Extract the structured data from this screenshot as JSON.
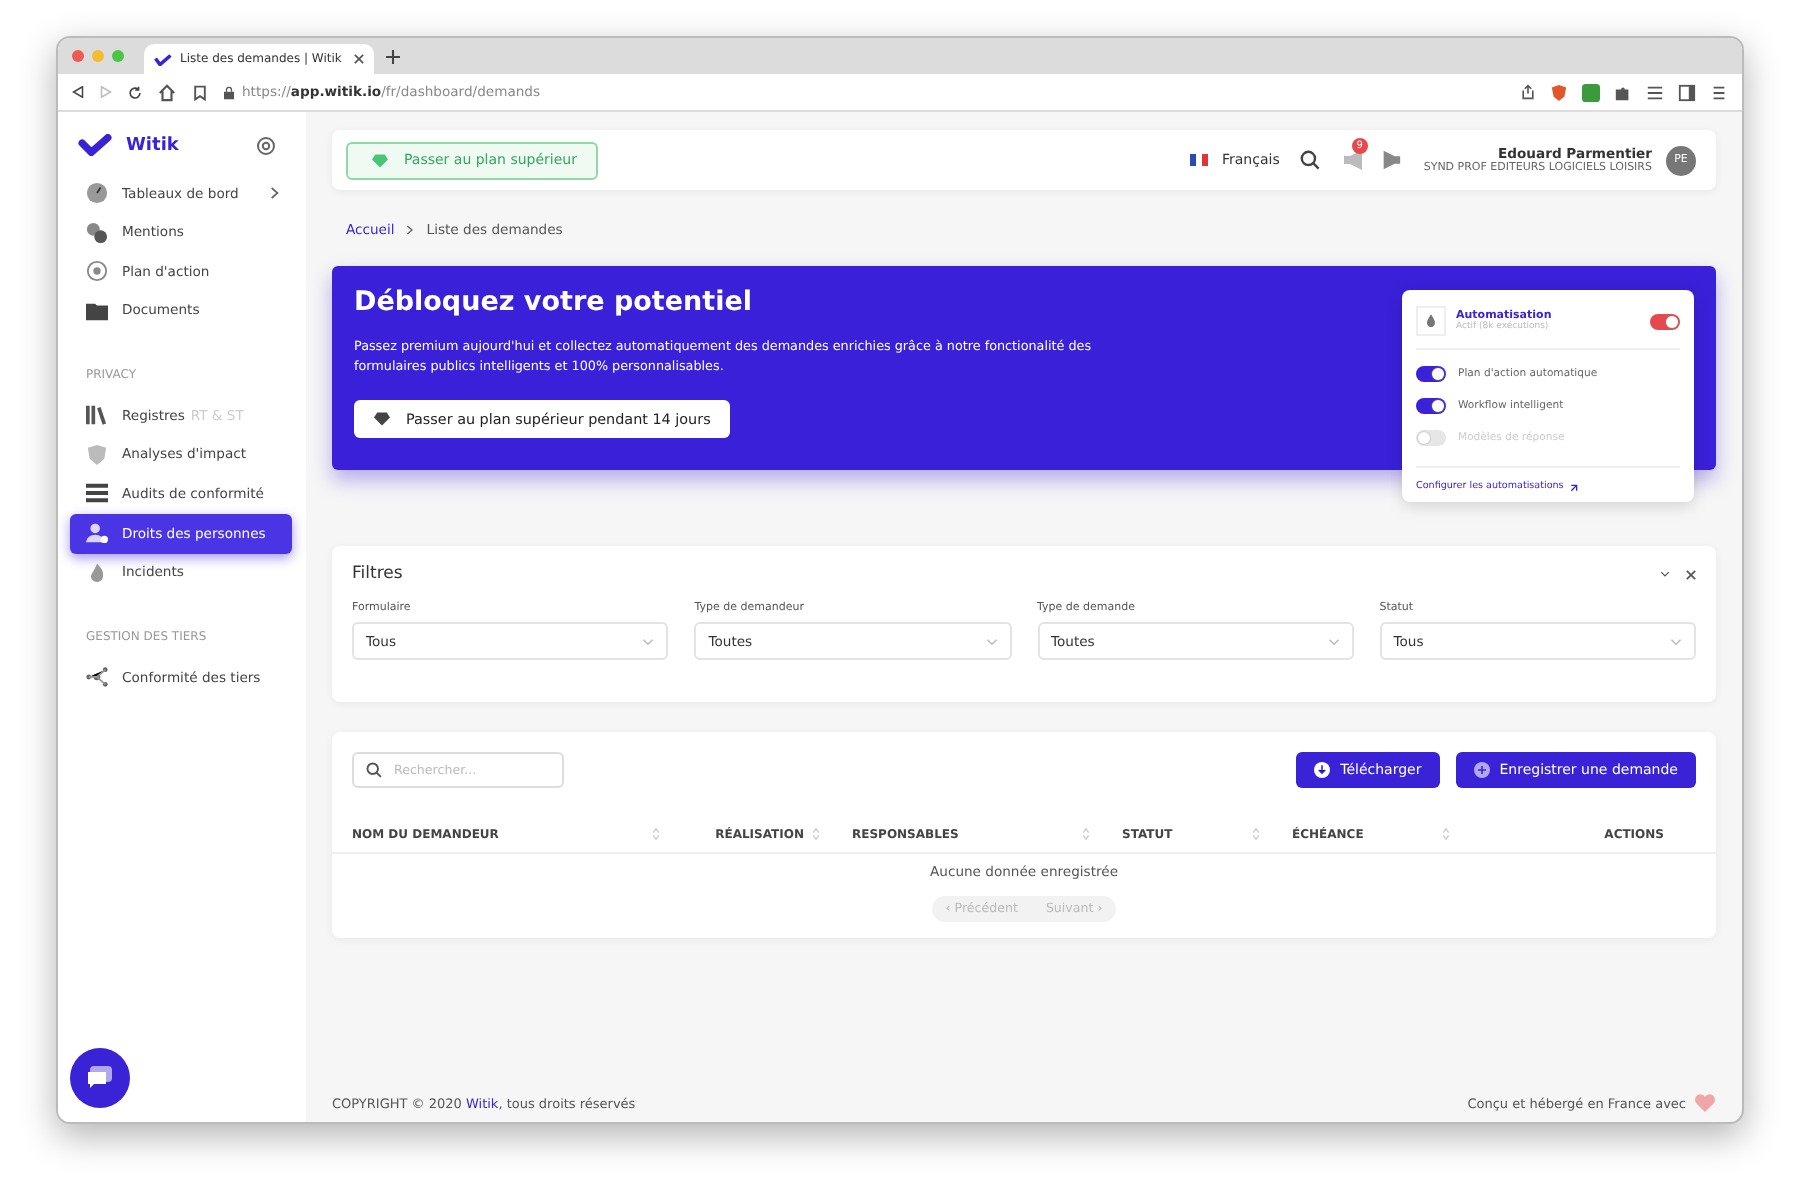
{
  "browser": {
    "tab_title": "Liste des demandes | Witik",
    "url": "https://**app.witik.io**/fr/dashboard/demands"
  },
  "sidebar": {
    "logo": "Witik",
    "sections": [
      {
        "items": [
          {
            "label": "Tableaux de bord",
            "selected": false,
            "has_submenu": true
          },
          {
            "label": "Mentions",
            "selected": false
          },
          {
            "label": "Plan d'action",
            "selected": false
          },
          {
            "label": "Documents",
            "selected": false
          }
        ]
      },
      {
        "heading": "PRIVACY",
        "items": [
          {
            "label": "Registres",
            "suffix": "RT & ST",
            "selected": false
          },
          {
            "label": "Analyses d'impact",
            "selected": false
          },
          {
            "label": "Audits de conformité",
            "selected": false
          },
          {
            "label": "Droits des personnes",
            "selected": true
          },
          {
            "label": "Incidents",
            "selected": false
          }
        ]
      },
      {
        "heading": "GESTION DES TIERS",
        "items": [
          {
            "label": "Conformité des tiers",
            "selected": false
          }
        ]
      }
    ]
  },
  "header": {
    "upgrade_button": "Passer au plan supérieur",
    "language": "Français",
    "notification_count": "9",
    "user_name": "Edouard Parmentier",
    "organization": "SYND PROF EDITEURS LOGICIELS LOISIRS",
    "avatar_initials": "PE"
  },
  "breadcrumb": [
    {
      "label": "Accueil",
      "link": true
    },
    {
      "label": "Liste des demandes",
      "link": false
    }
  ],
  "banner": {
    "title": "Débloquez votre potentiel",
    "text": "Passez premium aujourd'hui et collectez automatiquement des demandes enrichies grâce à notre fonctionalité des formulaires publics intelligents et 100% personnalisables.",
    "button": "Passer au plan supérieur pendant 14 jours",
    "automation": {
      "title": "Automatisation",
      "subtitle": "Actif (8k exécutions)",
      "on": true,
      "options": [
        {
          "label": "Plan d'action automatique",
          "on": true
        },
        {
          "label": "Workflow intelligent",
          "on": true
        },
        {
          "label": "Modèles de réponse",
          "on": false
        }
      ],
      "link": "Configurer les automatisations"
    }
  },
  "filters": {
    "title": "Filtres",
    "fields": [
      {
        "label": "Formulaire",
        "value": "Tous"
      },
      {
        "label": "Type de demandeur",
        "value": "Toutes"
      },
      {
        "label": "Type de demande",
        "value": "Toutes"
      },
      {
        "label": "Statut",
        "value": "Tous"
      }
    ]
  },
  "table": {
    "search_placeholder": "Rechercher...",
    "buttons": [
      "Télécharger",
      "Enregistrer une demande"
    ],
    "columns": [
      {
        "label": "NOM DU DEMANDEUR",
        "sortable": true
      },
      {
        "label": "RÉALISATION",
        "sortable": true
      },
      {
        "label": "RESPONSABLES",
        "sortable": true
      },
      {
        "label": "STATUT",
        "sortable": true
      },
      {
        "label": "ÉCHÉANCE",
        "sortable": true
      },
      {
        "label": "ACTIONS",
        "sortable": false
      }
    ],
    "empty_message": "Aucune donnée enregistrée",
    "pagination": [
      {
        "label": "‹ Précédent",
        "disabled": true
      },
      {
        "label": "Suivant ›",
        "disabled": true
      }
    ]
  },
  "footer": {
    "copyright_prefix": "COPYRIGHT © 2020 ",
    "brand": "Witik",
    "copyright_suffix": ", tous droits réservés",
    "made_in": "Conçu et hébergé en France avec"
  }
}
